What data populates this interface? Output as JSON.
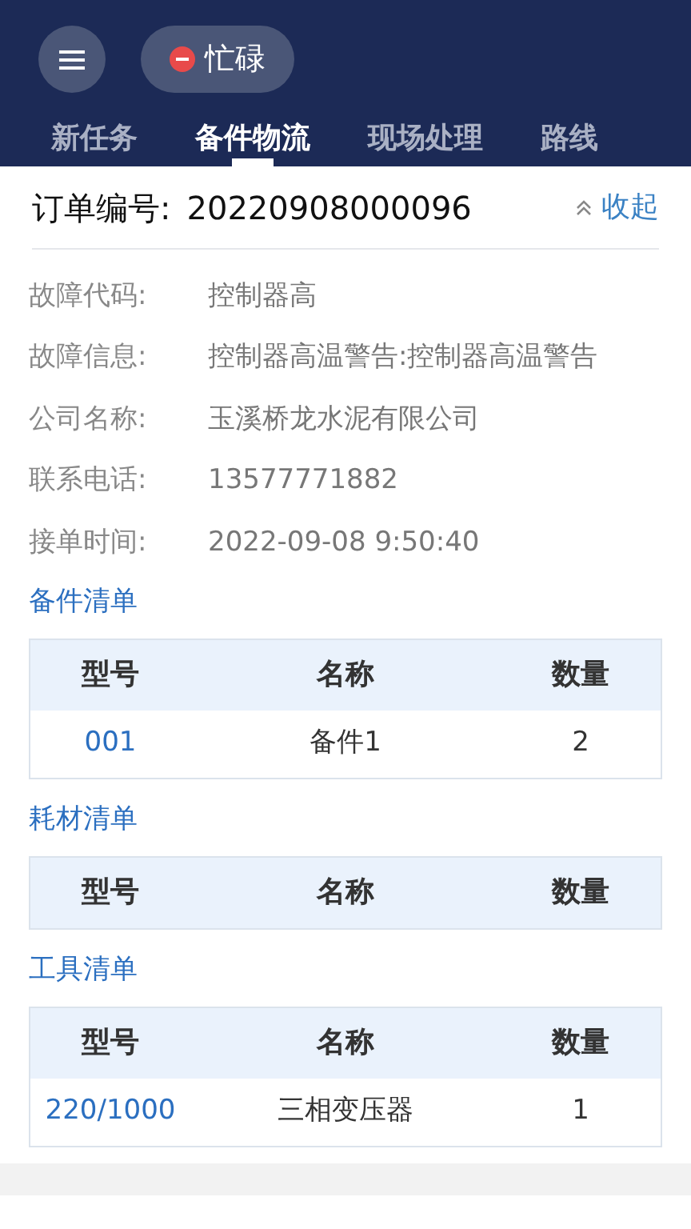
{
  "header": {
    "status": {
      "label": "忙碌"
    },
    "tabs": [
      {
        "label": "新任务",
        "selected": false
      },
      {
        "label": "备件物流",
        "selected": true
      },
      {
        "label": "现场处理",
        "selected": false
      },
      {
        "label": "路线",
        "selected": false
      }
    ]
  },
  "order": {
    "label": "订单编号:",
    "number": "20220908000096",
    "toggle": "收起"
  },
  "fields": [
    {
      "label": "故障代码:",
      "value": "控制器高"
    },
    {
      "label": "故障信息:",
      "value": "控制器高温警告:控制器高温警告"
    },
    {
      "label": "公司名称:",
      "value": "玉溪桥龙水泥有限公司"
    },
    {
      "label": "联系电话:",
      "value": "13577771882"
    },
    {
      "label": "接单时间:",
      "value": "2022-09-08 9:50:40"
    }
  ],
  "sections": [
    {
      "title": "备件清单",
      "columns": [
        "型号",
        "名称",
        "数量"
      ],
      "rows": [
        [
          "001",
          "备件1",
          "2"
        ]
      ]
    },
    {
      "title": "耗材清单",
      "columns": [
        "型号",
        "名称",
        "数量"
      ]
    },
    {
      "title": "工具清单",
      "columns": [
        "型号",
        "名称",
        "数量"
      ],
      "rows": [
        [
          "220/1000",
          "三相变压器",
          "1"
        ]
      ]
    }
  ]
}
